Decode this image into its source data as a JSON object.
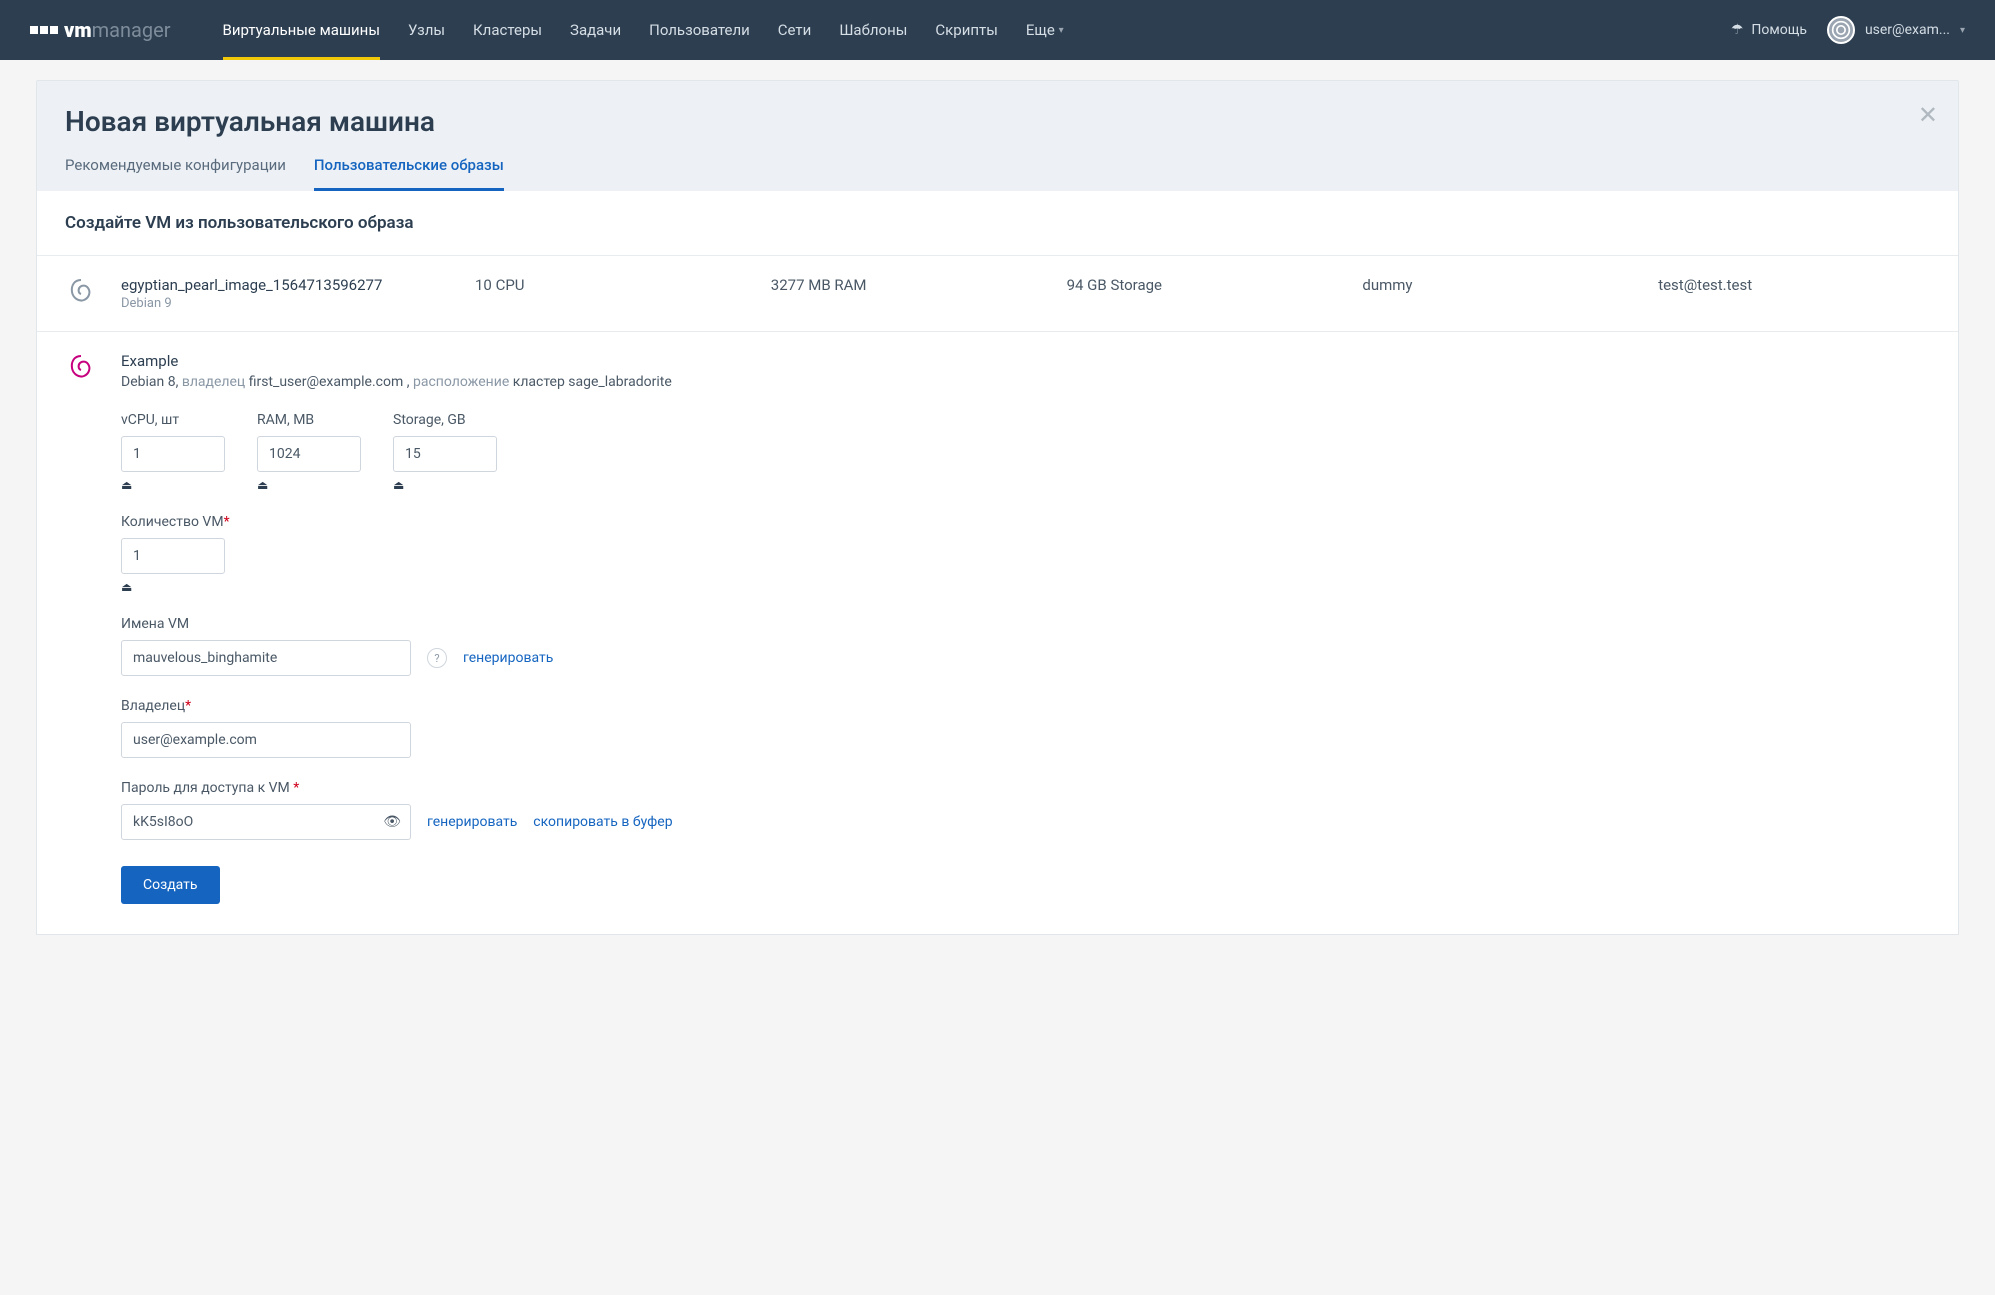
{
  "brand": {
    "vm": "vm",
    "manager": "manager"
  },
  "nav": {
    "vms": "Виртуальные машины",
    "nodes": "Узлы",
    "clusters": "Кластеры",
    "tasks": "Задачи",
    "users": "Пользователи",
    "networks": "Сети",
    "templates": "Шаблоны",
    "scripts": "Скрипты",
    "more": "Еще"
  },
  "top": {
    "help": "Помощь",
    "user": "user@exam..."
  },
  "page": {
    "title": "Новая виртуальная машина",
    "tab_recommended": "Рекомендуемые конфигурации",
    "tab_user_images": "Пользовательские образы",
    "section_title": "Создайте VM из пользовательского образа"
  },
  "image": {
    "name": "egyptian_pearl_image_1564713596277",
    "os": "Debian 9",
    "cpu": "10 CPU",
    "ram": "3277 MB RAM",
    "storage": "94 GB Storage",
    "note": "dummy",
    "email": "test@test.test"
  },
  "form": {
    "example": "Example",
    "meta_os": "Debian 8,",
    "meta_owner_label": "владелец",
    "meta_owner": "first_user@example.com ,",
    "meta_loc_label": "расположение",
    "meta_loc": "кластер sage_labradorite",
    "vcpu_label": "vCPU, шт",
    "vcpu_value": "1",
    "ram_label": "RAM, MB",
    "ram_value": "1024",
    "storage_label": "Storage, GB",
    "storage_value": "15",
    "count_label": "Количество VM",
    "count_value": "1",
    "names_label": "Имена VM",
    "names_value": "mauvelous_binghamite",
    "generate": "генерировать",
    "owner_label": "Владелец",
    "owner_value": "user@example.com",
    "password_label": "Пароль для доступа к VM",
    "password_value": "kK5sI8oO",
    "copy": "скопировать в буфер",
    "create": "Создать"
  }
}
